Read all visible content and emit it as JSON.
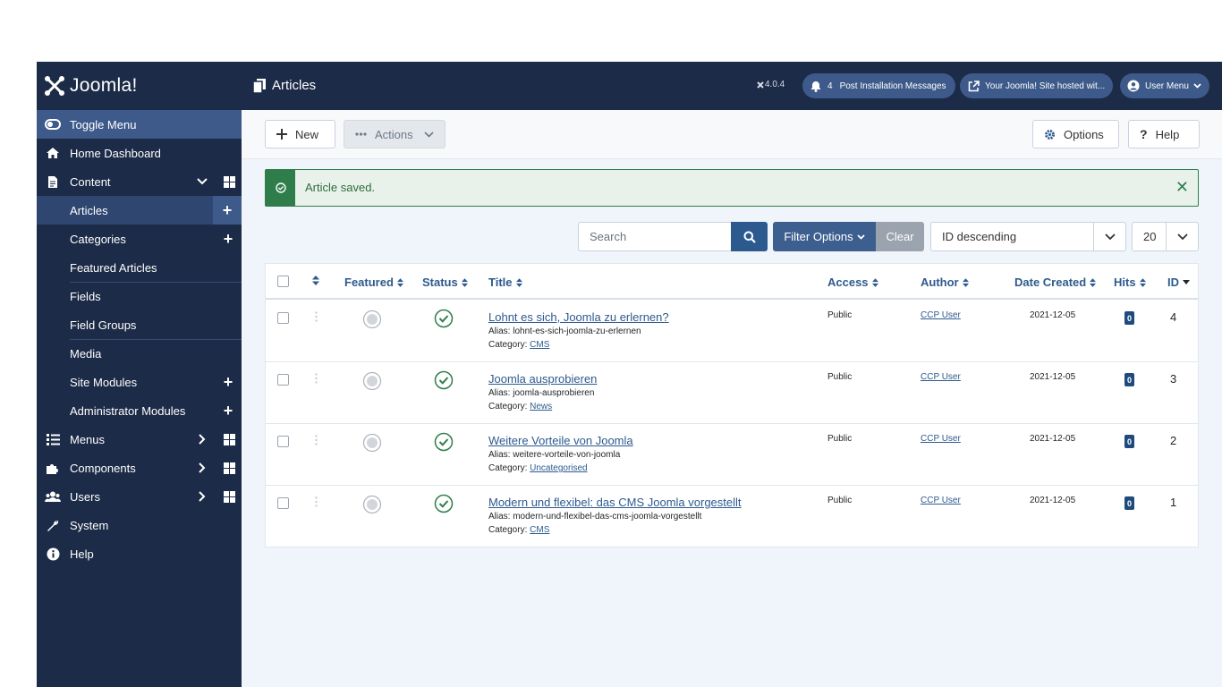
{
  "sidebar": {
    "logo_text": "Joomla!",
    "toggle_menu": "Toggle Menu",
    "home_dashboard": "Home Dashboard",
    "content": "Content",
    "items": [
      {
        "label": "Articles"
      },
      {
        "label": "Categories"
      },
      {
        "label": "Featured Articles"
      },
      {
        "label": "Fields"
      },
      {
        "label": "Field Groups"
      },
      {
        "label": "Media"
      },
      {
        "label": "Site Modules"
      },
      {
        "label": "Administrator Modules"
      }
    ],
    "menus": "Menus",
    "components": "Components",
    "users": "Users",
    "system": "System",
    "help": "Help"
  },
  "header": {
    "title": "Articles",
    "version": "4.0.4",
    "notifications_count": "4",
    "post_install": "Post Installation Messages",
    "site_link": "Your Joomla! Site hosted wit...",
    "user_menu": "User Menu"
  },
  "toolbar": {
    "new_label": "New",
    "actions_label": "Actions",
    "options_label": "Options",
    "help_label": "Help"
  },
  "alert": {
    "message": "Article saved."
  },
  "filters": {
    "search_placeholder": "Search",
    "filter_options_label": "Filter Options",
    "clear_label": "Clear",
    "ordering": "ID descending",
    "limit": "20"
  },
  "table": {
    "columns": {
      "featured": "Featured",
      "status": "Status",
      "title": "Title",
      "access": "Access",
      "author": "Author",
      "date_created": "Date Created",
      "hits": "Hits",
      "id": "ID"
    },
    "rows": [
      {
        "title": "Lohnt es sich, Joomla zu erlernen?",
        "alias_label": "Alias: lohnt-es-sich-joomla-zu-erlernen",
        "category_prefix": "Category:",
        "category": "CMS",
        "access": "Public",
        "author": "CCP User",
        "date": "2021-12-05",
        "hits": "0",
        "id": "4"
      },
      {
        "title": "Joomla ausprobieren",
        "alias_label": "Alias: joomla-ausprobieren",
        "category_prefix": "Category:",
        "category": "News",
        "access": "Public",
        "author": "CCP User",
        "date": "2021-12-05",
        "hits": "0",
        "id": "3"
      },
      {
        "title": "Weitere Vorteile von Joomla",
        "alias_label": "Alias: weitere-vorteile-von-joomla",
        "category_prefix": "Category:",
        "category": "Uncategorised",
        "access": "Public",
        "author": "CCP User",
        "date": "2021-12-05",
        "hits": "0",
        "id": "2"
      },
      {
        "title": "Modern und flexibel: das CMS Joomla vorgestellt",
        "alias_label": "Alias: modern-und-flexibel-das-cms-joomla-vorgestellt",
        "category_prefix": "Category:",
        "category": "CMS",
        "access": "Public",
        "author": "CCP User",
        "date": "2021-12-05",
        "hits": "0",
        "id": "1"
      }
    ]
  },
  "colors": {
    "sidebar_bg": "#1c2b47",
    "accent": "#2d5a8e",
    "success": "#2f7d4a"
  }
}
